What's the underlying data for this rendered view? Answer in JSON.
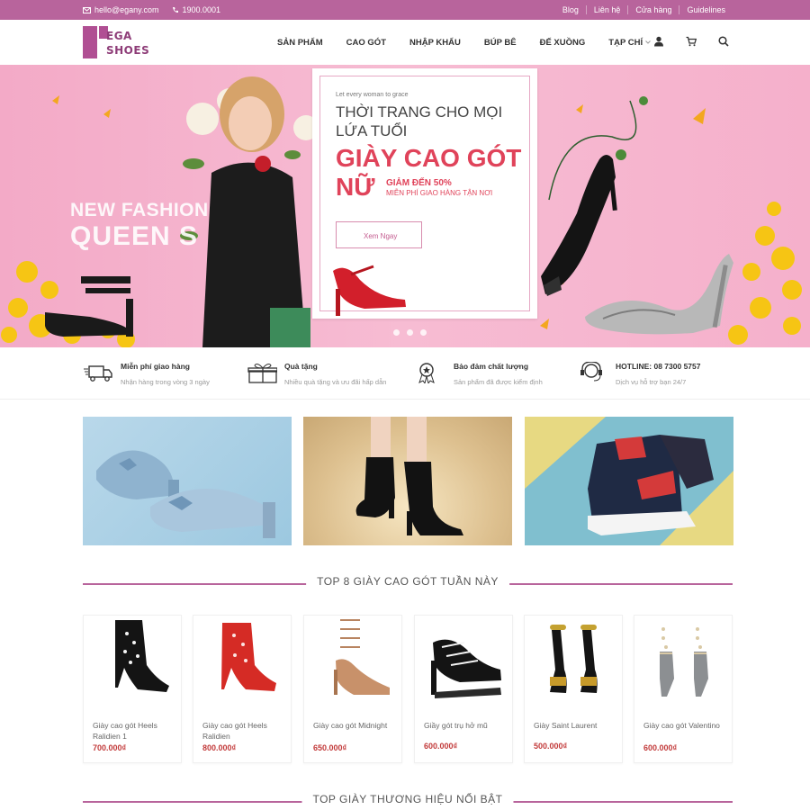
{
  "topbar": {
    "email": "hello@egany.com",
    "phone": "1900.0001",
    "links": [
      "Blog",
      "Liên hệ",
      "Cửa hàng",
      "Guidelines"
    ]
  },
  "brand": {
    "logo_line1": "EGA",
    "logo_line2": "SHOES"
  },
  "nav": {
    "items": [
      "SẢN PHẨM",
      "CAO GÓT",
      "NHẬP KHẨU",
      "BÚP BÊ",
      "ĐẾ XUỒNG",
      "TẠP CHÍ"
    ]
  },
  "hero": {
    "overlay_line1": "NEW FASHION",
    "overlay_line2": "QUEEN S",
    "promo_kicker": "Let every woman to grace",
    "promo_heading": "THỜI TRANG CHO MỌI LỨA TUỔI",
    "promo_highlight": "GIÀY CAO GÓT NỮ",
    "promo_discount": "GIẢM ĐẾN 50%",
    "promo_shipping": "MIỄN PHÍ GIAO HÀNG TẬN NƠI",
    "cta_label": "Xem Ngay"
  },
  "services": [
    {
      "icon": "truck-icon",
      "title": "Miễn phí giao hàng",
      "desc": "Nhận hàng trong vòng 3 ngày"
    },
    {
      "icon": "gift-icon",
      "title": "Quà tặng",
      "desc": "Nhiều quà tặng và ưu đãi hấp dẫn"
    },
    {
      "icon": "award-icon",
      "title": "Bảo đảm chất lượng",
      "desc": "Sản phẩm đã được kiểm định"
    },
    {
      "icon": "headset-icon",
      "title": "HOTLINE: 08 7300 5757",
      "desc": "Dịch vụ hỗ trợ bạn 24/7"
    }
  ],
  "sections": {
    "top8": "TOP 8 GIÀY CAO GÓT TUẦN NÀY",
    "brands": "TOP GIÀY THƯƠNG HIỆU NỔI BẬT"
  },
  "products": [
    {
      "name": "Giày cao gót Heels Ralidien 1",
      "price": "700.000₫"
    },
    {
      "name": "Giày cao gót Heels Ralidien",
      "price": "800.000₫"
    },
    {
      "name": "Giày cao gót Midnight",
      "price": "650.000₫"
    },
    {
      "name": "Giầy gót trụ hở mũ",
      "price": "600.000₫"
    },
    {
      "name": "Giày Saint Laurent",
      "price": "500.000₫"
    },
    {
      "name": "Giày cao gót Valentino",
      "price": "600.000₫"
    }
  ],
  "colors": {
    "accent": "#b8649c",
    "promo_red": "#e0435a",
    "price": "#c23a3a"
  }
}
